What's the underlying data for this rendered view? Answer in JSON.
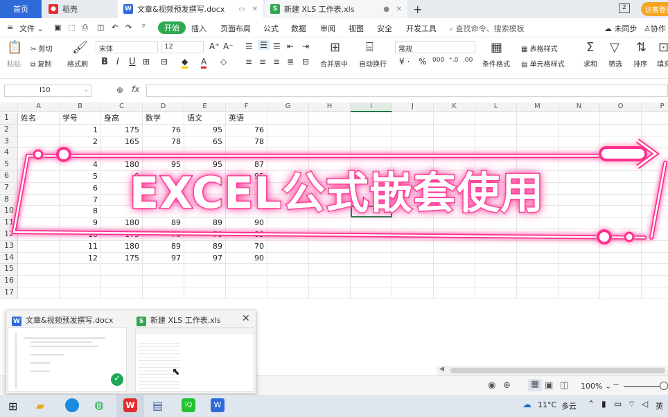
{
  "tabs": {
    "home": "首页",
    "t1": "稻壳",
    "t2": "文章&视频预发撰写.docx",
    "t3": "新建 XLS 工作表.xls",
    "add": "+",
    "counter": "2",
    "visitor": "访客登录"
  },
  "menubar": {
    "file": "文件",
    "items": [
      "开始",
      "插入",
      "页面布局",
      "公式",
      "数据",
      "审阅",
      "视图",
      "安全",
      "开发工具"
    ],
    "search": "查找命令、搜索模板",
    "sync": "未同步",
    "collab": "协作"
  },
  "ribbon": {
    "paste": "粘贴",
    "cut": "剪切",
    "copy": "复制",
    "format_painter": "格式刷",
    "font": "宋体",
    "font_size": "12",
    "merge": "合并居中",
    "wrap": "自动换行",
    "number_format": "常规",
    "cond_format": "条件格式",
    "table_style": "表格样式",
    "cell_style": "单元格样式",
    "sum": "求和",
    "filter": "筛选",
    "sort": "排序",
    "fill": "填充"
  },
  "formula": {
    "namebox": "I10",
    "fx": "fx"
  },
  "grid": {
    "columns": [
      "A",
      "B",
      "C",
      "D",
      "E",
      "F",
      "G",
      "H",
      "I",
      "J",
      "K",
      "L",
      "M",
      "N",
      "O",
      "P"
    ],
    "rows": [
      "1",
      "2",
      "3",
      "4",
      "5",
      "6",
      "7",
      "8",
      "10",
      "11",
      "12",
      "13",
      "14",
      "15",
      "16",
      "17"
    ],
    "header": [
      "姓名",
      "学号",
      "身高",
      "数学",
      "语文",
      "英语"
    ],
    "data": [
      [
        "",
        "1",
        "175",
        "76",
        "95",
        "76"
      ],
      [
        "",
        "2",
        "165",
        "78",
        "65",
        "78"
      ],
      [
        "",
        "",
        "",
        "",
        "",
        ""
      ],
      [
        "",
        "4",
        "180",
        "95",
        "95",
        "87"
      ],
      [
        "",
        "5",
        "0",
        "",
        "",
        "95"
      ],
      [
        "",
        "6",
        "",
        "87",
        "",
        ""
      ],
      [
        "",
        "7",
        "",
        "70",
        "",
        ""
      ],
      [
        "",
        "8",
        "",
        "",
        "",
        ""
      ],
      [
        "",
        "9",
        "180",
        "89",
        "89",
        "90"
      ],
      [
        "",
        "10",
        "175",
        "76",
        "76",
        "89"
      ],
      [
        "",
        "11",
        "180",
        "89",
        "89",
        "70"
      ],
      [
        "",
        "12",
        "175",
        "97",
        "97",
        "90"
      ]
    ]
  },
  "banner": {
    "text": "EXCEL公式嵌套使用"
  },
  "popup": {
    "w1": "文章&视频预发撰写.docx",
    "w2": "新建 XLS 工作表.xls"
  },
  "status": {
    "zoom": "100%"
  },
  "taskbar": {
    "temp": "11°C",
    "weather": "多云",
    "lang": "英"
  },
  "colors": {
    "accent": "#2f6ad9",
    "start_green": "#2fa84f",
    "banner_pink": "#e8207a"
  }
}
